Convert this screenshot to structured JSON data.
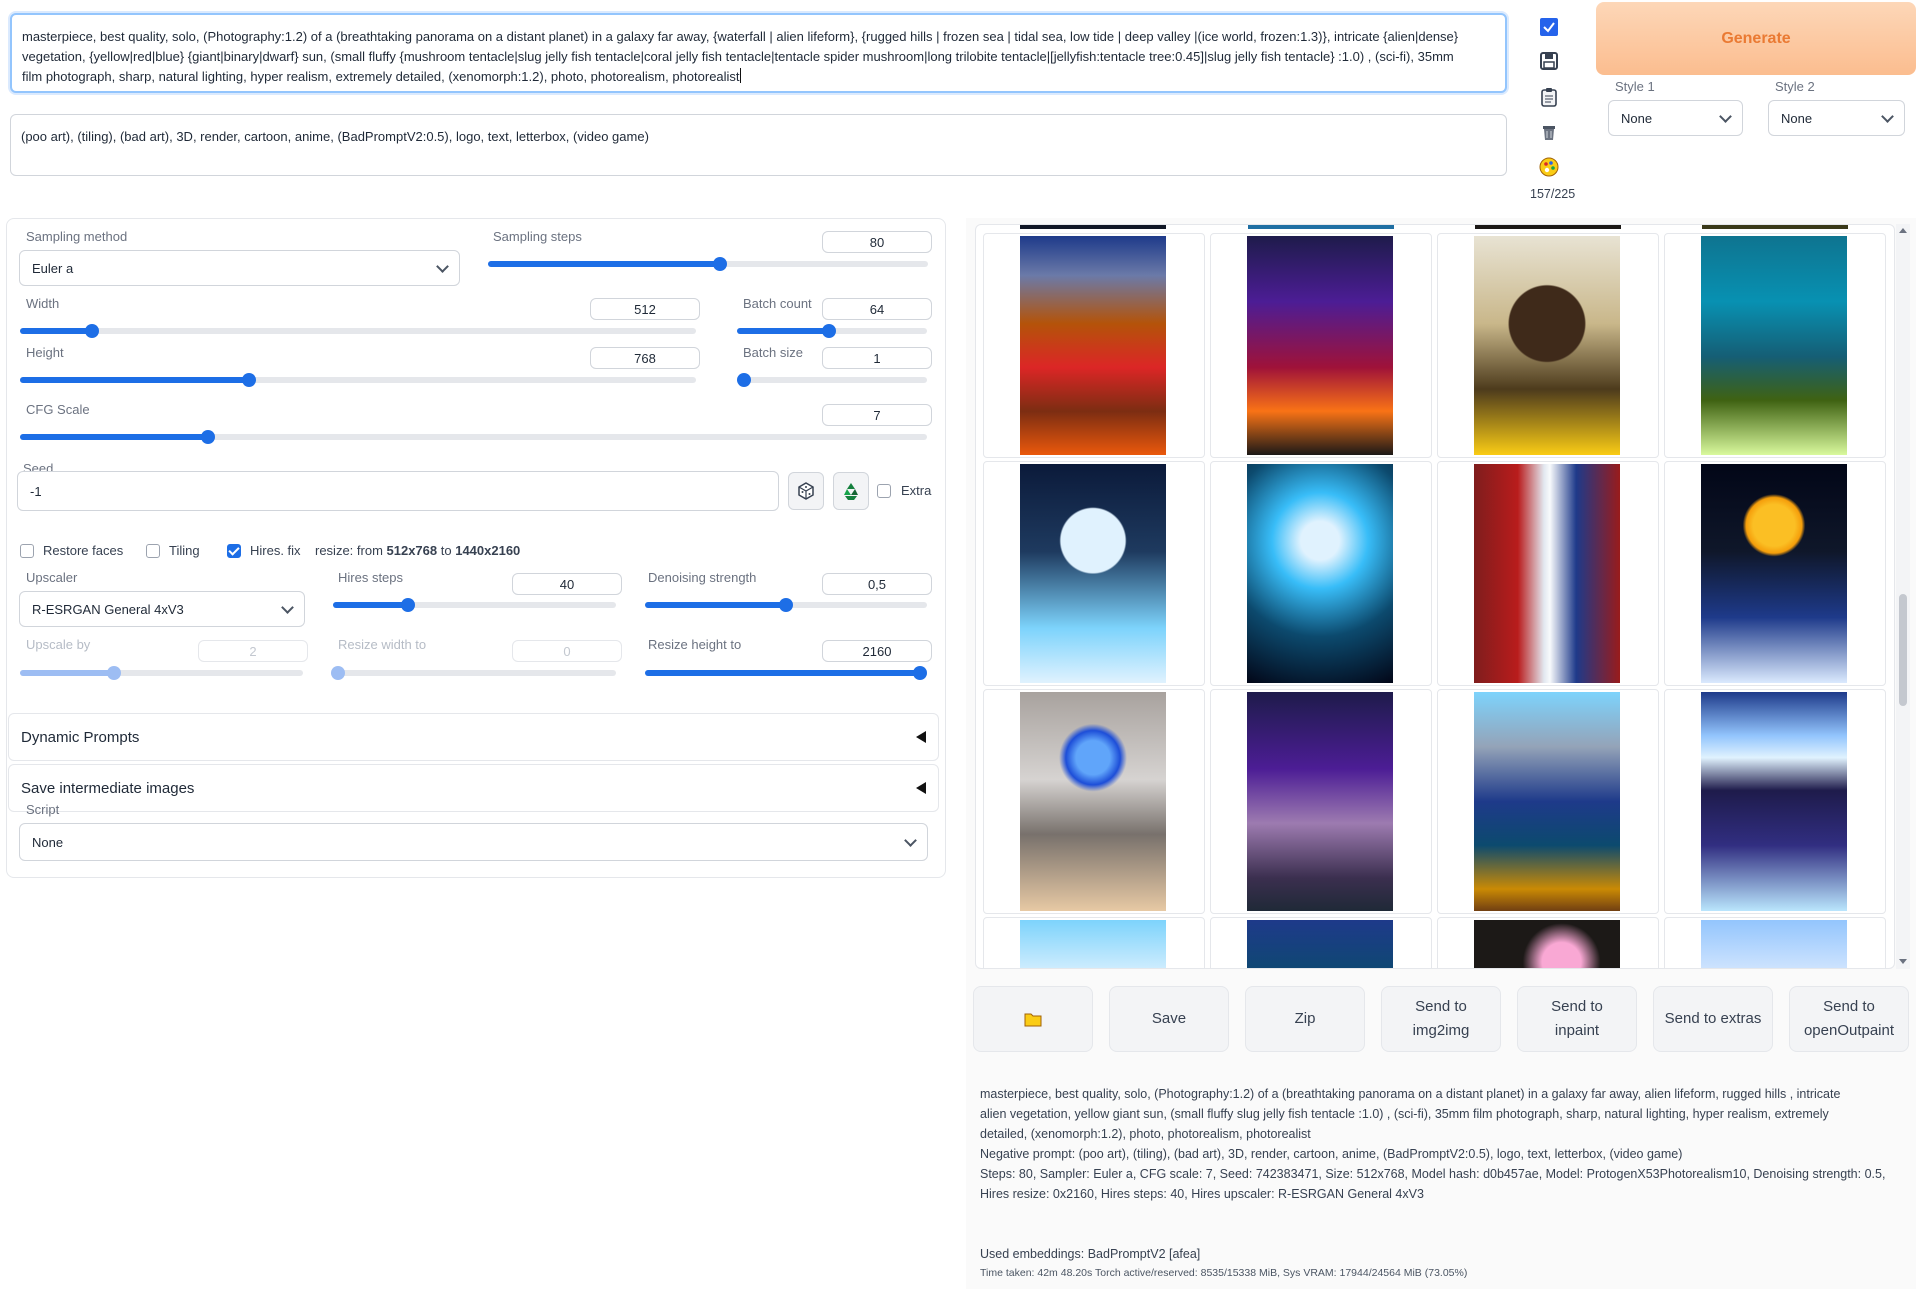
{
  "prompt": {
    "line1": "masterpiece, best quality, solo, (Photography:1.2) of a (breathtaking panorama on a distant planet) in a galaxy far away, {waterfall | alien lifeform}, {rugged hills | frozen sea | tidal sea, low tide | deep valley |(ice world, frozen:1.3)}, intricate {alien|dense}",
    "line2": "vegetation, {yellow|red|blue} {giant|binary|dwarf} sun, (small fluffy {mushroom tentacle|slug jelly fish tentacle|coral jelly fish tentacle|tentacle spider mushroom|long trilobite tentacle|[jellyfish:tentacle tree:0.45]|slug jelly fish tentacle} :1.0) , (sci-fi), 35mm",
    "line3": "film photograph, sharp, natural lighting, hyper realism, extremely detailed, (xenomorph:1.2), photo, photorealism, photorealist",
    "negative": "(poo art), (tiling), (bad art), 3D, render, cartoon, anime, (BadPromptV2:0.5), logo, text, letterbox, (video game)",
    "token_count": "157/225"
  },
  "generate_label": "Generate",
  "styles": {
    "style1_label": "Style 1",
    "style1_value": "None",
    "style2_label": "Style 2",
    "style2_value": "None"
  },
  "settings": {
    "sampling_method_label": "Sampling method",
    "sampling_method": "Euler a",
    "sampling_steps_label": "Sampling steps",
    "sampling_steps": "80",
    "sampling_steps_frac": 0.5263,
    "width_label": "Width",
    "width": "512",
    "width_frac": 0.1071,
    "height_label": "Height",
    "height": "768",
    "height_frac": 0.3393,
    "batch_count_label": "Batch count",
    "batch_count": "64",
    "batch_count_frac": 0.4844,
    "batch_size_label": "Batch size",
    "batch_size": "1",
    "batch_size_frac": 0.0,
    "cfg_label": "CFG Scale",
    "cfg": "7",
    "cfg_frac": 0.2069,
    "seed_label": "Seed",
    "seed": "-1",
    "extra_label": "Extra",
    "restore_faces_label": "Restore faces",
    "tiling_label": "Tiling",
    "hires_label": "Hires. fix",
    "resize_prefix": "resize: from ",
    "resize_from": "512x768",
    "resize_mid": " to ",
    "resize_to": "1440x2160",
    "upscaler_label": "Upscaler",
    "upscaler": "R-ESRGAN General 4xV3",
    "hires_steps_label": "Hires steps",
    "hires_steps": "40",
    "hires_steps_frac": 0.2667,
    "denoise_label": "Denoising strength",
    "denoise": "0,5",
    "denoise_frac": 0.5,
    "upscale_by_label": "Upscale by",
    "upscale_by": "2",
    "upscale_by_frac": 0.3333,
    "resize_width_label": "Resize width to",
    "resize_width": "0",
    "resize_width_frac": 0.0,
    "resize_height_label": "Resize height to",
    "resize_height": "2160",
    "resize_height_frac": 1.0,
    "dynamic_prompts": "Dynamic Prompts",
    "save_intermediate": "Save intermediate images",
    "script_label": "Script",
    "script": "None"
  },
  "actions": {
    "save": "Save",
    "zip": "Zip",
    "img2img_1": "Send to",
    "img2img_2": "img2img",
    "inpaint_1": "Send to",
    "inpaint_2": "inpaint",
    "extras": "Send to extras",
    "outpaint_1": "Send to",
    "outpaint_2": "openOutpaint"
  },
  "info": {
    "l1": "masterpiece, best quality, solo, (Photography:1.2) of a (breathtaking panorama on a distant planet) in a galaxy far away, alien lifeform, rugged hills , intricate",
    "l2": "alien vegetation, yellow giant sun, (small fluffy slug jelly fish tentacle :1.0) , (sci-fi), 35mm film photograph, sharp, natural lighting, hyper realism, extremely",
    "l3": "detailed, (xenomorph:1.2), photo, photorealism, photorealist",
    "l4": "Negative prompt: (poo art), (tiling), (bad art), 3D, render, cartoon, anime, (BadPromptV2:0.5), logo, text, letterbox, (video game)",
    "l5": "Steps: 80, Sampler: Euler a, CFG scale: 7, Seed: 742383471, Size: 512x768, Model hash: d0b457ae, Model: ProtogenX53Photorealism10, Denoising strength: 0.5,",
    "l6": "Hires resize: 0x2160, Hires steps: 40, Hires upscaler: R-ESRGAN General 4xV3",
    "embeddings": "Used embeddings: BadPromptV2 [afea]",
    "time": "Time taken: 42m 48.20s  Torch active/reserved: 8535/15338 MiB, Sys VRAM: 17944/24564 MiB (73.05%)"
  },
  "colors": {
    "accent": "#1d6ee6",
    "generate_bg": "#fbbd8f",
    "generate_text": "#ea7a33"
  }
}
